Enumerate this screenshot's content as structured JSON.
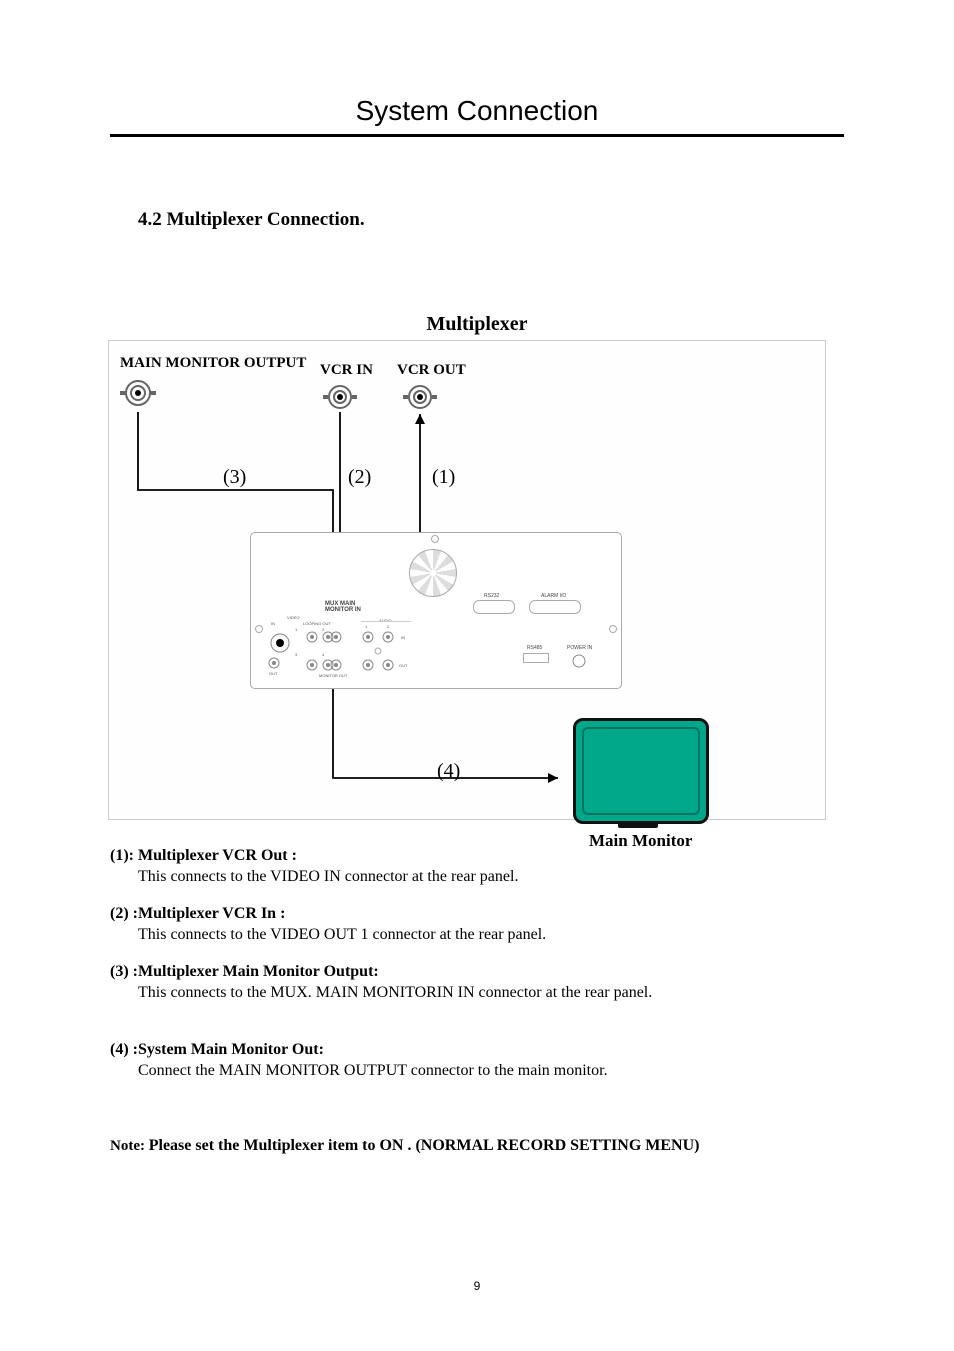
{
  "page": {
    "title": "System Connection",
    "number": "9"
  },
  "section": {
    "heading": "4.2  Multiplexer  Connection.",
    "diagram_title": "Multiplexer"
  },
  "labels": {
    "main_monitor_output": "MAIN MONITOR OUTPUT",
    "vcr_in": "VCR IN",
    "vcr_out": "VCR OUT",
    "n1": "(1)",
    "n2": "(2)",
    "n3": "(3)",
    "n4": "(4)",
    "main_monitor": "Main Monitor"
  },
  "device": {
    "mux_main": "MUX MAIN\nMONITOR IN",
    "video": "VIDEO",
    "looping_out": "LOOPING OUT",
    "in": "IN",
    "out": "OUT",
    "audio": "AUDIO",
    "monitor_out": "MONITOR OUT",
    "audio_in": "IN",
    "audio_out": "OUT",
    "rs232": "RS232",
    "alarm_io": "ALARM I/O",
    "rs485": "RS485",
    "power_in": "POWER IN",
    "c1": "1",
    "c2": "2",
    "c3": "3",
    "c4": "4",
    "a1": "1",
    "a2": "2"
  },
  "descriptions": [
    {
      "heading": "(1): Multiplexer VCR Out :",
      "body": "This connects to the VIDEO IN connector at the rear panel."
    },
    {
      "heading": "(2) :Multiplexer VCR In :",
      "body": "This connects to the VIDEO OUT 1 connector at the rear panel."
    },
    {
      "heading": "(3) :Multiplexer Main Monitor Output:",
      "body": "This connects to the MUX. MAIN MONITORIN IN connector at the rear panel."
    },
    {
      "heading": "(4) :System Main Monitor Out:",
      "body": "Connect the MAIN MONITOR OUTPUT connector to the main monitor."
    }
  ],
  "note": {
    "label": "Note: ",
    "text": "Please set the Multiplexer item to ON . (NORMAL RECORD SETTING MENU)"
  }
}
